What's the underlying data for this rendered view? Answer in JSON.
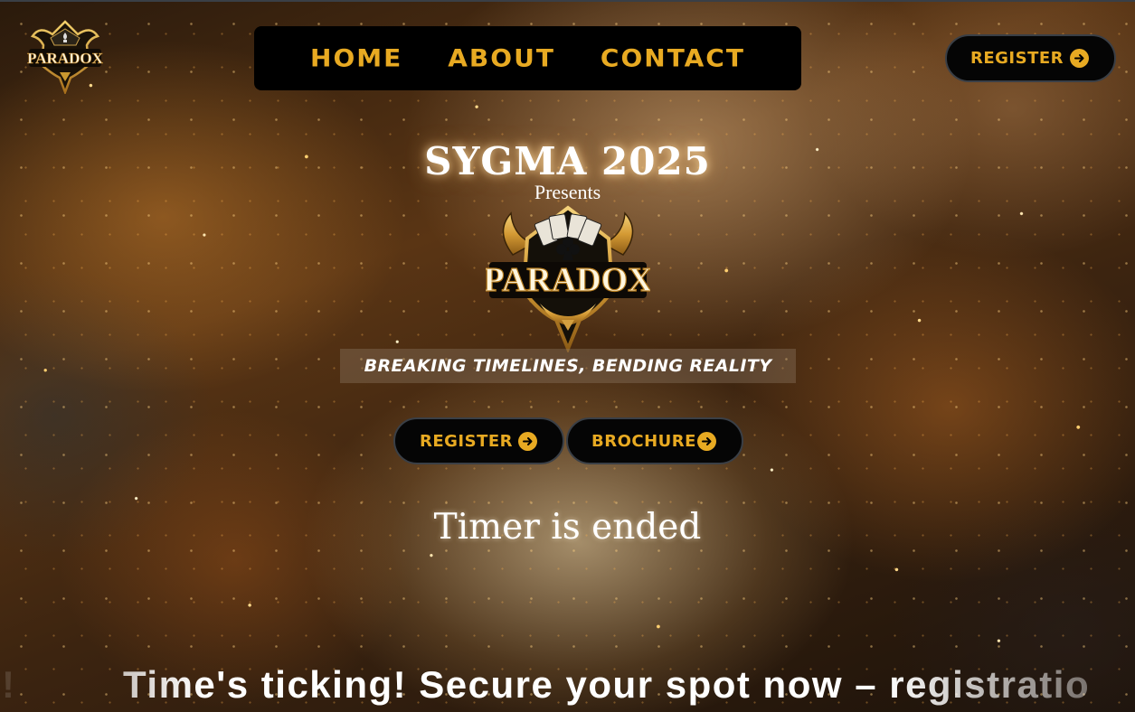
{
  "brand": {
    "logo_text": "PARADOX"
  },
  "nav": {
    "items": [
      {
        "label": "HOME"
      },
      {
        "label": "ABOUT"
      },
      {
        "label": "CONTACT"
      }
    ]
  },
  "header": {
    "register_label": "REGISTER",
    "register_icon": "arrow-right-circle-icon"
  },
  "hero": {
    "title": "SYGMA 2025",
    "presents": "Presents",
    "logo_text": "PARADOX",
    "tagline": "BREAKING TIMELINES, BENDING REALITY",
    "register_label": "REGISTER",
    "brochure_label": "BROCHURE",
    "timer_text": "Timer is ended"
  },
  "marquee": {
    "tail": "!",
    "text": "Time's ticking! Secure your spot now – registratio"
  },
  "colors": {
    "accent": "#e8aa22",
    "nav_bg": "#000000",
    "text": "#ffffff"
  }
}
